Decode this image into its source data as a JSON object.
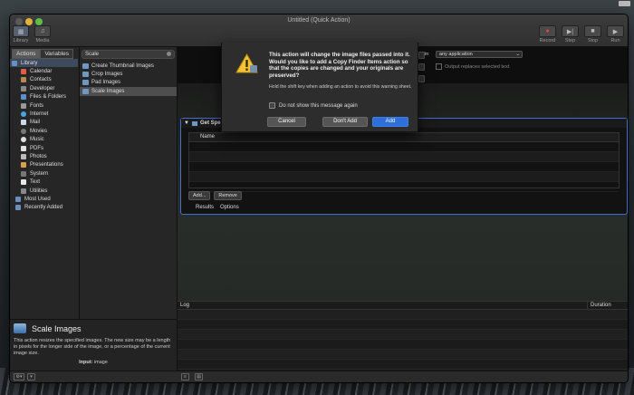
{
  "window": {
    "title": "Untitled (Quick Action)"
  },
  "toolbar": {
    "left": [
      "Library",
      "Media"
    ],
    "right": [
      "Record",
      "Step",
      "Stop",
      "Run"
    ]
  },
  "sidebar": {
    "tab_actions": "Actions",
    "tab_variables": "Variables",
    "library_label": "Library",
    "items": [
      "Calendar",
      "Contacts",
      "Developer",
      "Files & Folders",
      "Fonts",
      "Internet",
      "Mail",
      "Movies",
      "Music",
      "PDFs",
      "Photos",
      "Presentations",
      "System",
      "Text",
      "Utilities"
    ],
    "bottom_items": [
      "Most Used",
      "Recently Added"
    ]
  },
  "search": {
    "value": "Scale"
  },
  "actions_list": [
    "Create Thumbnail Images",
    "Crop Images",
    "Pad Images",
    "Scale Images"
  ],
  "description": {
    "title": "Scale Images",
    "text": "This action resizes the specified images. The new size may be a length in pixels for the longer side of the image, or a percentage of the current image size.",
    "input_label": "Input:",
    "input_value": "image"
  },
  "workflow": {
    "in_label": "in",
    "application_dropdown": "any application",
    "output_replaces": "Output replaces selected text"
  },
  "action_box": {
    "title": "Get Spe",
    "column_name": "Name",
    "add_button": "Add...",
    "remove_button": "Remove",
    "tab_results": "Results",
    "tab_options": "Options"
  },
  "log": {
    "header": "Log",
    "duration": "Duration"
  },
  "dialog": {
    "title": "This action will change the image files passed into it. Would you like to add a Copy Finder Items action so that the copies are changed and your originals are preserved?",
    "info": "Hold the shift key when adding an action to avoid this warning sheet.",
    "checkbox": "Do not show this message again",
    "cancel": "Cancel",
    "dont_add": "Don't Add",
    "add": "Add"
  },
  "colors": {
    "accent": "#2f6fdb",
    "selection_border": "#3f6fd6"
  }
}
